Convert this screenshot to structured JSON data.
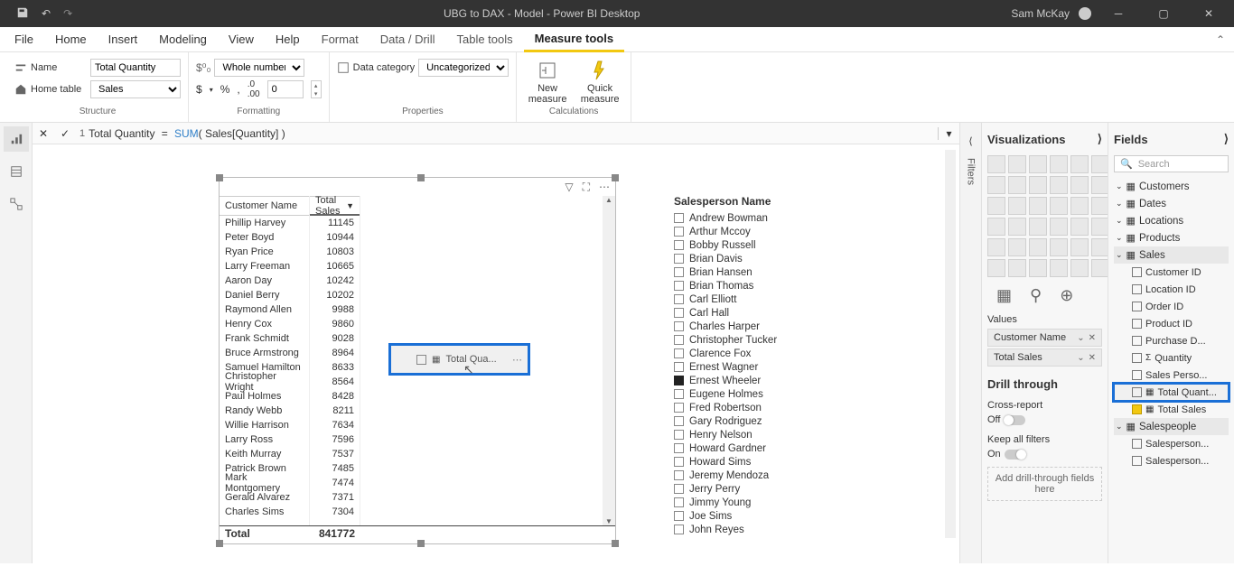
{
  "titlebar": {
    "title": "UBG to DAX - Model - Power BI Desktop",
    "user": "Sam McKay"
  },
  "tabs": {
    "file": "File",
    "home": "Home",
    "insert": "Insert",
    "modeling": "Modeling",
    "view": "View",
    "help": "Help",
    "format": "Format",
    "data_drill": "Data / Drill",
    "table_tools": "Table tools",
    "measure_tools": "Measure tools"
  },
  "ribbon": {
    "structure": {
      "label": "Structure",
      "name_label": "Name",
      "name_value": "Total Quantity",
      "home_table_label": "Home table",
      "home_table_value": "Sales"
    },
    "formatting": {
      "label": "Formatting",
      "format_type": "Whole number",
      "decimals": "0",
      "currency": "$",
      "percent": "%",
      "comma": ",",
      "dp": ".0"
    },
    "properties": {
      "label": "Properties",
      "data_category_label": "Data category",
      "data_category_value": "Uncategorized"
    },
    "calculations": {
      "label": "Calculations",
      "new_measure": "New measure",
      "quick_measure": "Quick measure"
    }
  },
  "formula": {
    "line": "1",
    "name": "Total Quantity",
    "eq": "=",
    "func": "SUM",
    "args": "( Sales[Quantity] )"
  },
  "table_visual": {
    "columns": [
      "Customer Name",
      "Total Sales"
    ],
    "rows": [
      {
        "name": "Phillip Harvey",
        "val": "11145"
      },
      {
        "name": "Peter Boyd",
        "val": "10944"
      },
      {
        "name": "Ryan Price",
        "val": "10803"
      },
      {
        "name": "Larry Freeman",
        "val": "10665"
      },
      {
        "name": "Aaron Day",
        "val": "10242"
      },
      {
        "name": "Daniel Berry",
        "val": "10202"
      },
      {
        "name": "Raymond Allen",
        "val": "9988"
      },
      {
        "name": "Henry Cox",
        "val": "9860"
      },
      {
        "name": "Frank Schmidt",
        "val": "9028"
      },
      {
        "name": "Bruce Armstrong",
        "val": "8964"
      },
      {
        "name": "Samuel Hamilton",
        "val": "8633"
      },
      {
        "name": "Christopher Wright",
        "val": "8564"
      },
      {
        "name": "Paul Holmes",
        "val": "8428"
      },
      {
        "name": "Randy Webb",
        "val": "8211"
      },
      {
        "name": "Willie Harrison",
        "val": "7634"
      },
      {
        "name": "Larry Ross",
        "val": "7596"
      },
      {
        "name": "Keith Murray",
        "val": "7537"
      },
      {
        "name": "Patrick Brown",
        "val": "7485"
      },
      {
        "name": "Mark Montgomery",
        "val": "7474"
      },
      {
        "name": "Gerald Alvarez",
        "val": "7371"
      },
      {
        "name": "Charles Sims",
        "val": "7304"
      }
    ],
    "total_label": "Total",
    "total_value": "841772"
  },
  "drag": {
    "label": "Total Qua..."
  },
  "slicer": {
    "title": "Salesperson Name",
    "items": [
      {
        "n": "Andrew Bowman",
        "c": false
      },
      {
        "n": "Arthur Mccoy",
        "c": false
      },
      {
        "n": "Bobby Russell",
        "c": false
      },
      {
        "n": "Brian Davis",
        "c": false
      },
      {
        "n": "Brian Hansen",
        "c": false
      },
      {
        "n": "Brian Thomas",
        "c": false
      },
      {
        "n": "Carl Elliott",
        "c": false
      },
      {
        "n": "Carl Hall",
        "c": false
      },
      {
        "n": "Charles Harper",
        "c": false
      },
      {
        "n": "Christopher Tucker",
        "c": false
      },
      {
        "n": "Clarence Fox",
        "c": false
      },
      {
        "n": "Ernest Wagner",
        "c": false
      },
      {
        "n": "Ernest Wheeler",
        "c": true
      },
      {
        "n": "Eugene Holmes",
        "c": false
      },
      {
        "n": "Fred Robertson",
        "c": false
      },
      {
        "n": "Gary Rodriguez",
        "c": false
      },
      {
        "n": "Henry Nelson",
        "c": false
      },
      {
        "n": "Howard Gardner",
        "c": false
      },
      {
        "n": "Howard Sims",
        "c": false
      },
      {
        "n": "Jeremy Mendoza",
        "c": false
      },
      {
        "n": "Jerry Perry",
        "c": false
      },
      {
        "n": "Jimmy Young",
        "c": false
      },
      {
        "n": "Joe Sims",
        "c": false
      },
      {
        "n": "John Reyes",
        "c": false
      }
    ]
  },
  "filters_rail": {
    "label": "Filters"
  },
  "viz_pane": {
    "title": "Visualizations",
    "values_label": "Values",
    "wells": [
      "Customer Name",
      "Total Sales"
    ],
    "drill_title": "Drill through",
    "cross_report": "Cross-report",
    "off": "Off",
    "keep_filters": "Keep all filters",
    "on": "On",
    "drop_hint": "Add drill-through fields here"
  },
  "fields_pane": {
    "title": "Fields",
    "search_ph": "Search",
    "tables": [
      {
        "name": "Customers",
        "exp": false
      },
      {
        "name": "Dates",
        "exp": false
      },
      {
        "name": "Locations",
        "exp": false
      },
      {
        "name": "Products",
        "exp": false
      }
    ],
    "sales_table": "Sales",
    "sales_cols": [
      {
        "n": "Customer ID",
        "chk": false,
        "ico": ""
      },
      {
        "n": "Location ID",
        "chk": false,
        "ico": ""
      },
      {
        "n": "Order ID",
        "chk": false,
        "ico": ""
      },
      {
        "n": "Product ID",
        "chk": false,
        "ico": ""
      },
      {
        "n": "Purchase D...",
        "chk": false,
        "ico": ""
      },
      {
        "n": "Quantity",
        "chk": false,
        "ico": "Σ"
      },
      {
        "n": "Sales Perso...",
        "chk": false,
        "ico": ""
      },
      {
        "n": "Total Quant...",
        "chk": false,
        "ico": "▦",
        "hl": true
      },
      {
        "n": "Total Sales",
        "chk": true,
        "ico": "▦"
      }
    ],
    "salespeople_table": "Salespeople",
    "sp_cols": [
      {
        "n": "Salesperson...",
        "chk": false
      },
      {
        "n": "Salesperson...",
        "chk": false
      }
    ]
  }
}
